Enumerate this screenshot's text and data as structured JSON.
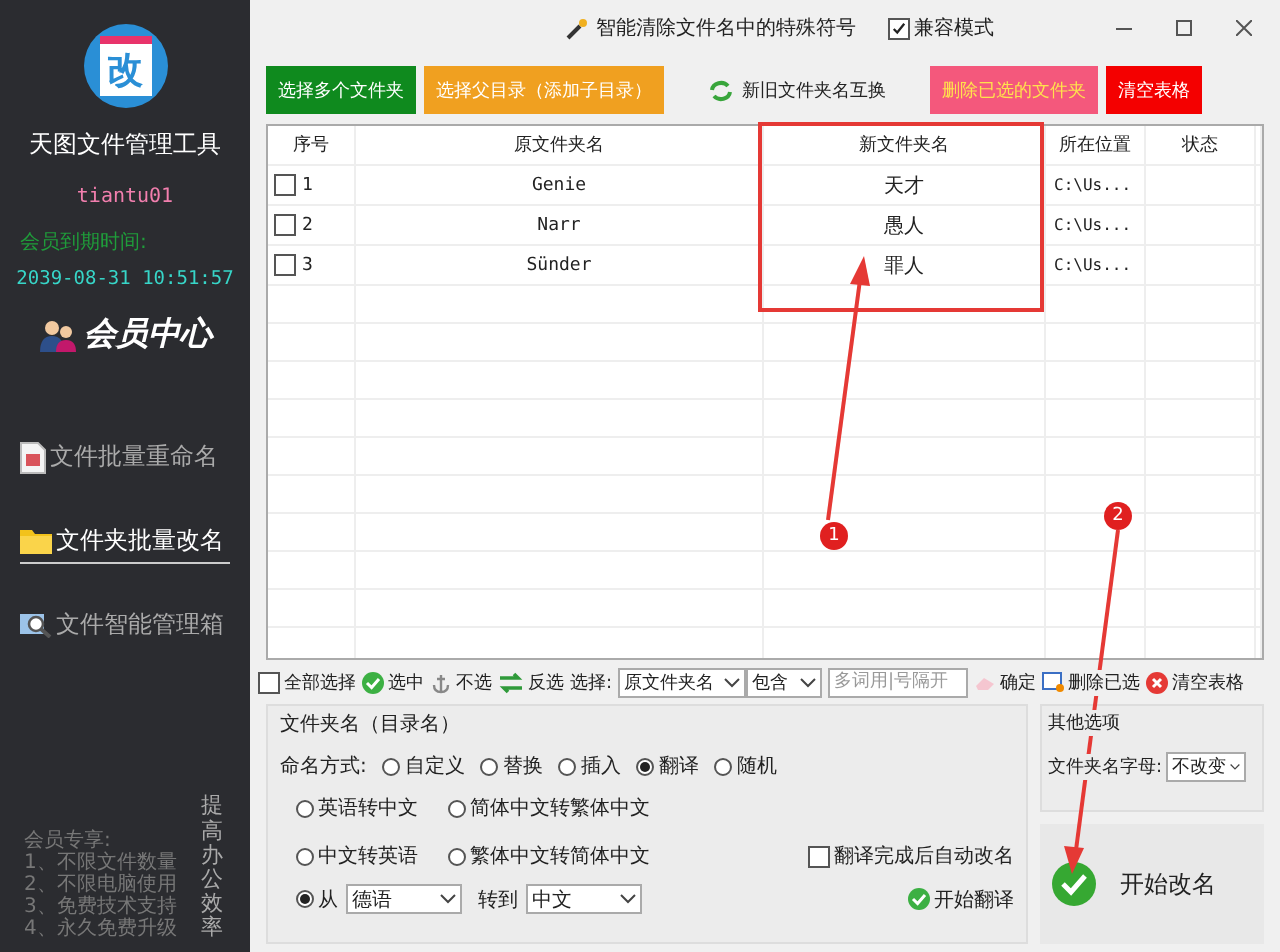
{
  "sidebar": {
    "logo_text": "改",
    "app_name": "天图文件管理工具",
    "username": "tiantu01",
    "expiry_label": "会员到期时间:",
    "expiry": "2039-08-31 10:51:57",
    "member_center": "会员中心",
    "nav": [
      {
        "label": "文件批量重命名",
        "selected": false
      },
      {
        "label": "文件夹批量改名",
        "selected": true
      },
      {
        "label": "文件智能管理箱",
        "selected": false
      }
    ],
    "perks_title": "会员专享:",
    "perks": [
      "1、不限文件数量",
      "2、不限电脑使用",
      "3、免费技术支持",
      "4、永久免费升级"
    ],
    "slogan": "提高办公效率"
  },
  "title_bar": {
    "tool": "智能清除文件名中的特殊符号",
    "compat": {
      "label": "兼容模式",
      "checked": true
    }
  },
  "actions": [
    {
      "label": "选择多个文件夹",
      "kind": "filled",
      "color": "#0f8a1e"
    },
    {
      "label": "选择父目录（添加子目录）",
      "kind": "filled",
      "color": "#f0a020"
    },
    {
      "label": "新旧文件夹名互换",
      "kind": "plain"
    },
    {
      "label": "删除已选的文件夹",
      "kind": "filled",
      "color": "#f4587c"
    },
    {
      "label": "清空表格",
      "kind": "filled",
      "color": "#f40000"
    }
  ],
  "table": {
    "columns": [
      "序号",
      "原文件夹名",
      "新文件夹名",
      "所在位置",
      "状态"
    ],
    "rows": [
      {
        "index": "1",
        "checked": false,
        "original": "Genie",
        "new": "天才",
        "location": "C:\\Us..."
      },
      {
        "index": "2",
        "checked": false,
        "original": "Narr",
        "new": "愚人",
        "location": "C:\\Us..."
      },
      {
        "index": "3",
        "checked": false,
        "original": "Sünder",
        "new": "罪人",
        "location": "C:\\Us..."
      }
    ]
  },
  "filter_bar": {
    "select_all": {
      "label": "全部选择",
      "checked": false
    },
    "buttons": [
      {
        "label": "选中"
      },
      {
        "label": "不选"
      },
      {
        "label": "反选"
      }
    ],
    "select_label": "选择:",
    "field": "原文件夹名",
    "match": "包含",
    "keyword_placeholder": "多词用|号隔开",
    "confirm": "确定",
    "delete_selected": "删除已选",
    "clear": "清空表格"
  },
  "rename": {
    "title": "文件夹名（目录名）",
    "mode_label": "命名方式:",
    "modes": [
      {
        "label": "自定义",
        "selected": false
      },
      {
        "label": "替换",
        "selected": false
      },
      {
        "label": "插入",
        "selected": false
      },
      {
        "label": "翻译",
        "selected": true
      },
      {
        "label": "随机",
        "selected": false
      }
    ],
    "directions": [
      {
        "label": "英语转中文",
        "selected": false
      },
      {
        "label": "简体中文转繁体中文",
        "selected": false
      },
      {
        "label": "中文转英语",
        "selected": false
      },
      {
        "label": "繁体中文转简体中文",
        "selected": false
      }
    ],
    "auto_rename": {
      "label": "翻译完成后自动改名",
      "checked": false
    },
    "from": {
      "label": "从",
      "selected": true,
      "value": "德语"
    },
    "to_label": "转到",
    "to": "中文",
    "translate": "开始翻译"
  },
  "other": {
    "title": "其他选项",
    "case_label": "文件夹名字母:",
    "case": "不改变"
  },
  "start": "开始改名",
  "annotations": [
    "1",
    "2"
  ]
}
